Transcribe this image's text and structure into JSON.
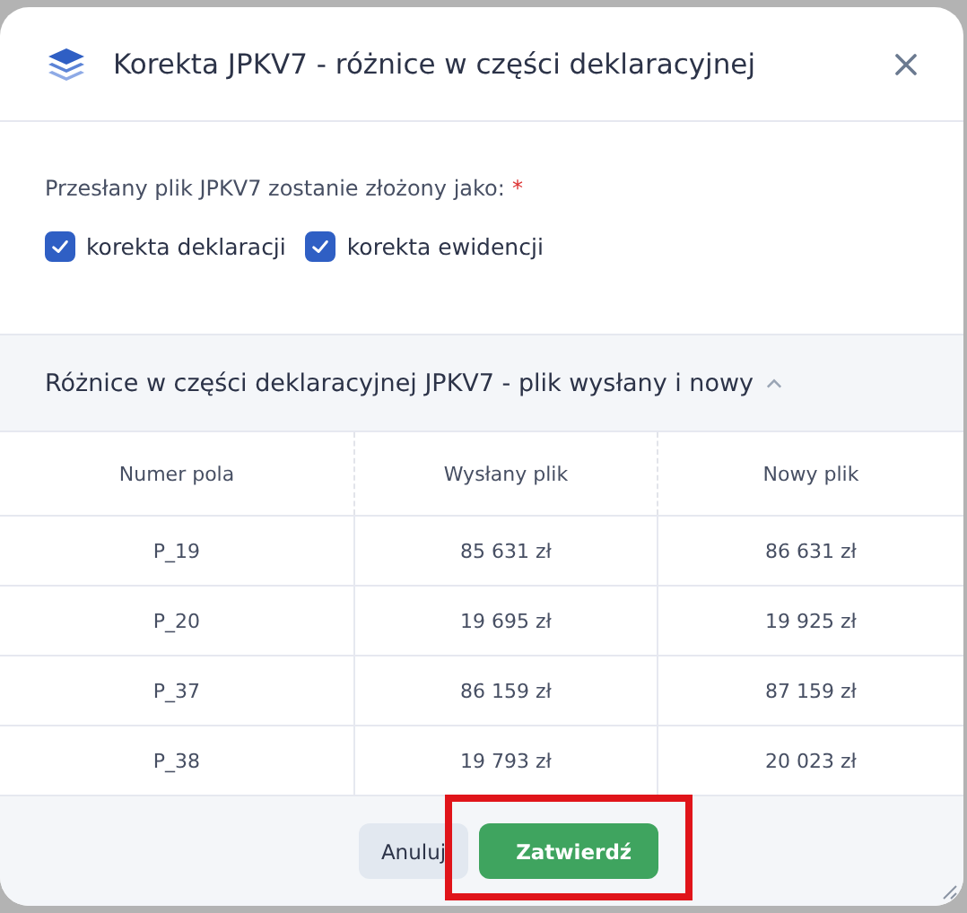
{
  "dialog": {
    "title": "Korekta JPKV7 - różnice w części deklaracyjnej"
  },
  "form": {
    "label": "Przesłany plik JPKV7 zostanie złożony jako:",
    "required_mark": "*",
    "options": [
      {
        "label": "korekta deklaracji",
        "checked": true
      },
      {
        "label": "korekta ewidencji",
        "checked": true
      }
    ]
  },
  "section": {
    "title": "Różnice w części deklaracyjnej JPKV7 - plik wysłany i nowy",
    "expanded": true
  },
  "table": {
    "columns": [
      "Numer pola",
      "Wysłany plik",
      "Nowy plik"
    ],
    "rows": [
      [
        "P_19",
        "85 631 zł",
        "86 631 zł"
      ],
      [
        "P_20",
        "19 695 zł",
        "19 925 zł"
      ],
      [
        "P_37",
        "86 159 zł",
        "87 159 zł"
      ],
      [
        "P_38",
        "19 793 zł",
        "20 023 zł"
      ]
    ]
  },
  "buttons": [
    {
      "label": "Anuluj",
      "kind": "secondary",
      "highlighted": false
    },
    {
      "label": "Zatwierdź",
      "kind": "primary",
      "highlighted": true
    }
  ]
}
